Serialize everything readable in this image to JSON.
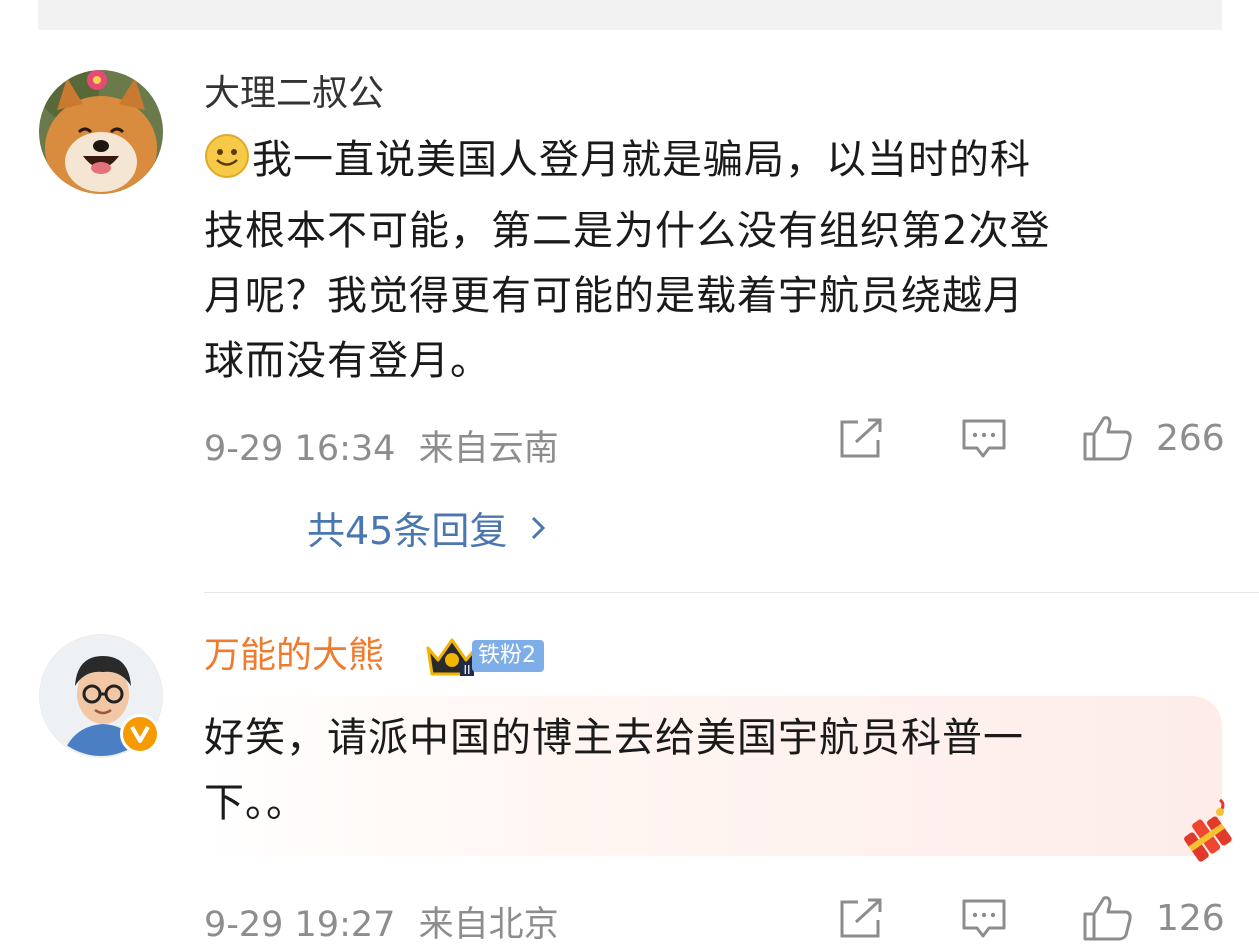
{
  "comments": [
    {
      "username": "大理二叔公",
      "text_lines": [
        "我一直说美国人登月就是骗局，以当时的科",
        "技根本不可能，第二是为什么没有组织第2次登",
        "月呢？我觉得更有可能的是载着宇航员绕越月",
        "球而没有登月。"
      ],
      "time": "9-29 16:34",
      "location": "来自云南",
      "likes": "266",
      "replies_label": "共45条回复"
    },
    {
      "username": "万能的大熊",
      "username_color": "#f07a2e",
      "fan_badge": "铁粉2",
      "text_lines": [
        "好笑，请派中国的博主去给美国宇航员科普一",
        "下。。"
      ],
      "time": "9-29 19:27",
      "location": "来自北京",
      "likes": "126"
    }
  ],
  "icons": {
    "emoji": "smile-emoji-icon",
    "share": "share-icon",
    "comment": "comment-icon",
    "like": "thumbs-up-icon",
    "verified": "verified-v-icon",
    "crown": "crown-icon",
    "firecracker": "firecracker-icon"
  },
  "colors": {
    "link_blue": "#4b77b0",
    "meta_gray": "#8d8d8d",
    "verified_orange": "#f59a00"
  }
}
